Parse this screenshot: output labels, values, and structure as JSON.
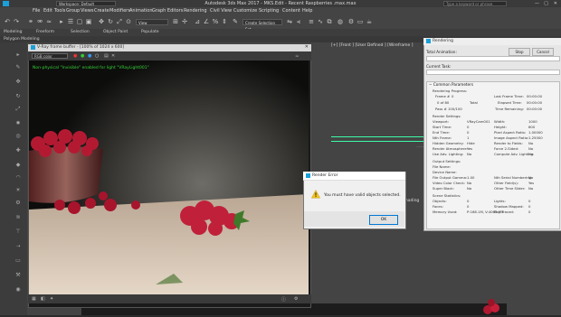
{
  "app": {
    "title": "Autodesk 3ds Max 2017 - MKS.Edit - Recent Raspberries .max.max",
    "search_placeholder": "Type a keyword or phrase",
    "window_controls": [
      "—",
      "□",
      "✕"
    ]
  },
  "menubar": {
    "workspace_label": "Workspace: Default",
    "items": [
      "File",
      "Edit",
      "Tools",
      "Group",
      "Views",
      "Create",
      "Modifiers",
      "Animation",
      "Graph Editors",
      "Rendering",
      "Civil View",
      "Customize",
      "Scripting",
      "Content",
      "Help"
    ]
  },
  "toolbar": {
    "view_select": "View",
    "selection_set": "Create Selection Set"
  },
  "ribbon": {
    "tabs": [
      "Modeling",
      "Freeform",
      "Selection",
      "Object Paint",
      "Populate"
    ],
    "sub_label": "Polygon Modeling"
  },
  "viewport": {
    "label": "[+] [Front ] [User Defined ] [Wireframe ]",
    "side_label": "Shading"
  },
  "vfb": {
    "title": "V-Ray frame buffer - [100% of 1024 x 600]",
    "channel": "RGB color",
    "warning": "Non-physical \"Invisible\" enabled for light \"VRayLight001\""
  },
  "rendering_dialog": {
    "title": "Rendering",
    "total_animation": "Total Animation:",
    "current_task": "Current Task:",
    "stop": "Stop",
    "cancel": "Cancel",
    "common_params": "Common Parameters",
    "rendering_progress": "Rendering Progress:",
    "frame_label": "Frame #",
    "frame_value": "0",
    "of_label": "0 of 80",
    "total_label": "Total",
    "pass_label": "Pass #",
    "pass_value": "100/100",
    "last_frame_time_label": "Last Frame Time:",
    "last_frame_time": "00:00:00",
    "elapsed_time_label": "Elapsed Time:",
    "elapsed_time": "00:00:00",
    "time_remaining_label": "Time Remaining:",
    "time_remaining": "00:00:00",
    "render_settings": "Render Settings:",
    "settings_left": [
      [
        "Viewport:",
        "VRayCam001"
      ],
      [
        "Start Time:",
        "0"
      ],
      [
        "End Time:",
        "0"
      ],
      [
        "Nth Frame:",
        "1"
      ],
      [
        "Hidden Geometry:",
        "Hide"
      ],
      [
        "Render Atmosphere:",
        "Yes"
      ],
      [
        "Use Adv. Lighting:",
        "No"
      ]
    ],
    "settings_right": [
      [
        "Width:",
        "1000"
      ],
      [
        "Height:",
        "600"
      ],
      [
        "Pixel Aspect Ratio:",
        "1.00000"
      ],
      [
        "Image Aspect Ratio:",
        "1.25000"
      ],
      [
        "Render to Fields:",
        "No"
      ],
      [
        "Force 2-Sided:",
        "No"
      ],
      [
        "Compute Adv. Lighting:",
        "No"
      ]
    ],
    "output_settings": "Output Settings:",
    "output_left": [
      [
        "File Name:",
        ""
      ],
      [
        "Device Name:",
        ""
      ],
      [
        "File Output Gamma:",
        "1.00"
      ],
      [
        "Video Color Check:",
        "No"
      ],
      [
        "Super Black:",
        "No"
      ]
    ],
    "output_right": [
      [
        "Nth Serial Numbering:",
        "No"
      ],
      [
        "Other Field(s):",
        "Yes"
      ],
      [
        "Other Time Slider:",
        "No"
      ]
    ],
    "scene_statistics": "Scene Statistics:",
    "stats_left": [
      [
        "Objects:",
        "0"
      ],
      [
        "Faces:",
        "0"
      ],
      [
        "Memory Used:",
        "P:168.1M, V:4063.9M"
      ]
    ],
    "stats_right": [
      [
        "Lights:",
        "0"
      ],
      [
        "Shadow Mapped:",
        "0"
      ],
      [
        "Ray Traced:",
        "0"
      ]
    ]
  },
  "error_dialog": {
    "title": "Render Error",
    "message": "You must have valid objects selected.",
    "ok": "OK"
  },
  "colors": {
    "accent": "#0078d7",
    "warning_text": "#37d437",
    "warning_icon": "#f5c518",
    "guide_green": "#3dfca8"
  }
}
